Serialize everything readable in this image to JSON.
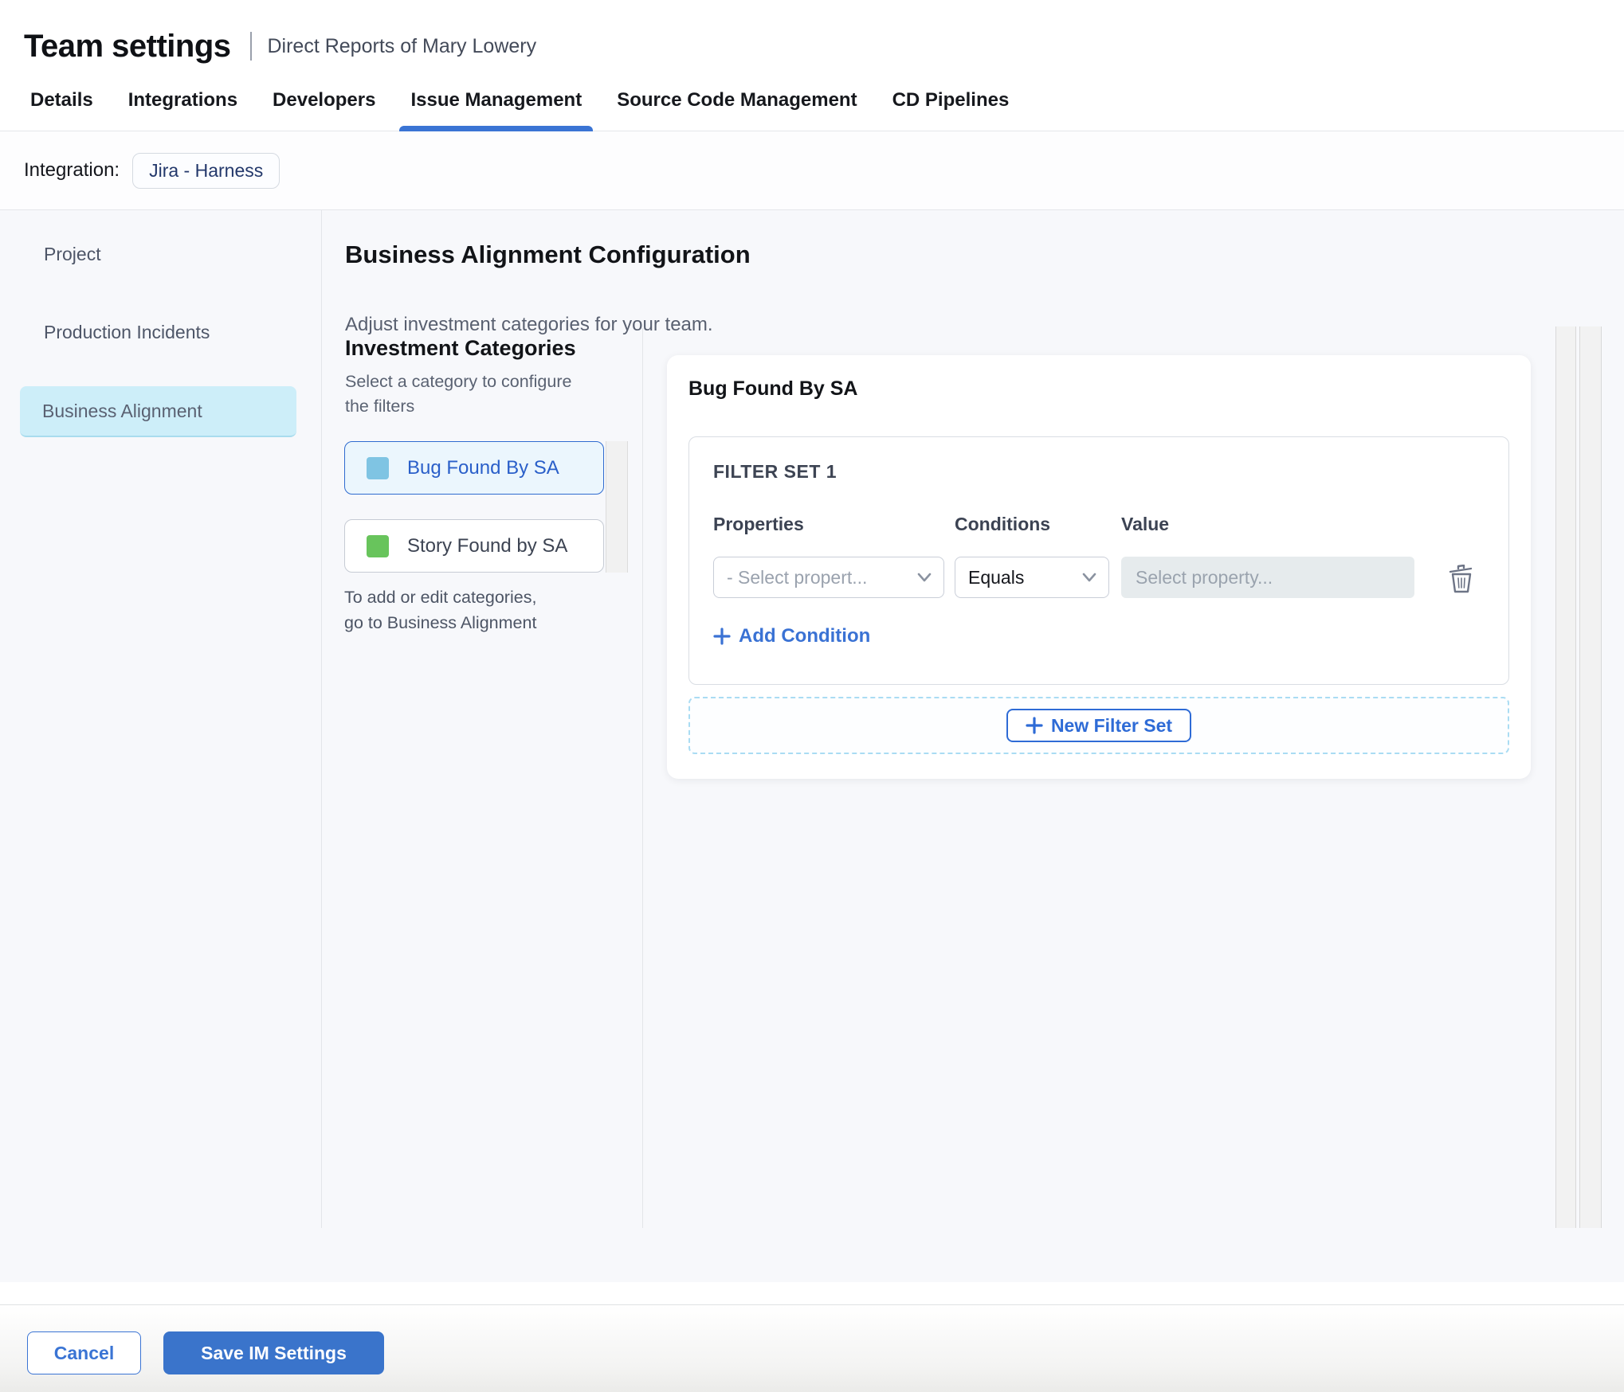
{
  "header": {
    "title": "Team settings",
    "subtitle": "Direct Reports of Mary Lowery"
  },
  "tabs": [
    {
      "label": "Details",
      "active": false
    },
    {
      "label": "Integrations",
      "active": false
    },
    {
      "label": "Developers",
      "active": false
    },
    {
      "label": "Issue Management",
      "active": true
    },
    {
      "label": "Source Code Management",
      "active": false
    },
    {
      "label": "CD Pipelines",
      "active": false
    }
  ],
  "integration": {
    "label": "Integration:",
    "value": "Jira - Harness"
  },
  "sidebar": {
    "items": [
      {
        "label": "Project",
        "selected": false
      },
      {
        "label": "Production Incidents",
        "selected": false
      },
      {
        "label": "Business Alignment",
        "selected": true
      }
    ]
  },
  "main": {
    "title": "Business Alignment Configuration",
    "subtitle": "Adjust investment categories for your team.",
    "categories_panel": {
      "title": "Investment Categories",
      "subtitle": "Select a category to configure the filters",
      "items": [
        {
          "label": "Bug Found By SA",
          "swatch_color": "#7fc4e3",
          "selected": true
        },
        {
          "label": "Story Found by SA",
          "swatch_color": "#68c45c",
          "selected": false
        }
      ],
      "footnote": "To add or edit categories, go to Business Alignment"
    },
    "config_card": {
      "title": "Bug Found By SA",
      "filter_set": {
        "title": "FILTER SET 1",
        "columns": [
          "Properties",
          "Conditions",
          "Value"
        ],
        "row": {
          "property_placeholder": "- Select propert...",
          "condition_value": "Equals",
          "value_placeholder": "Select property..."
        },
        "add_condition_label": "Add Condition"
      },
      "new_filter_set_label": "New Filter Set"
    }
  },
  "footer": {
    "cancel_label": "Cancel",
    "save_label": "Save IM Settings"
  },
  "colors": {
    "accent_blue": "#3a74d4",
    "nav_selected_bg": "#cdeef9",
    "category_selected_bg": "#ebf6fd",
    "bug_swatch": "#7fc4e3",
    "story_swatch": "#68c45c",
    "save_button_bg": "#3a74cb"
  }
}
